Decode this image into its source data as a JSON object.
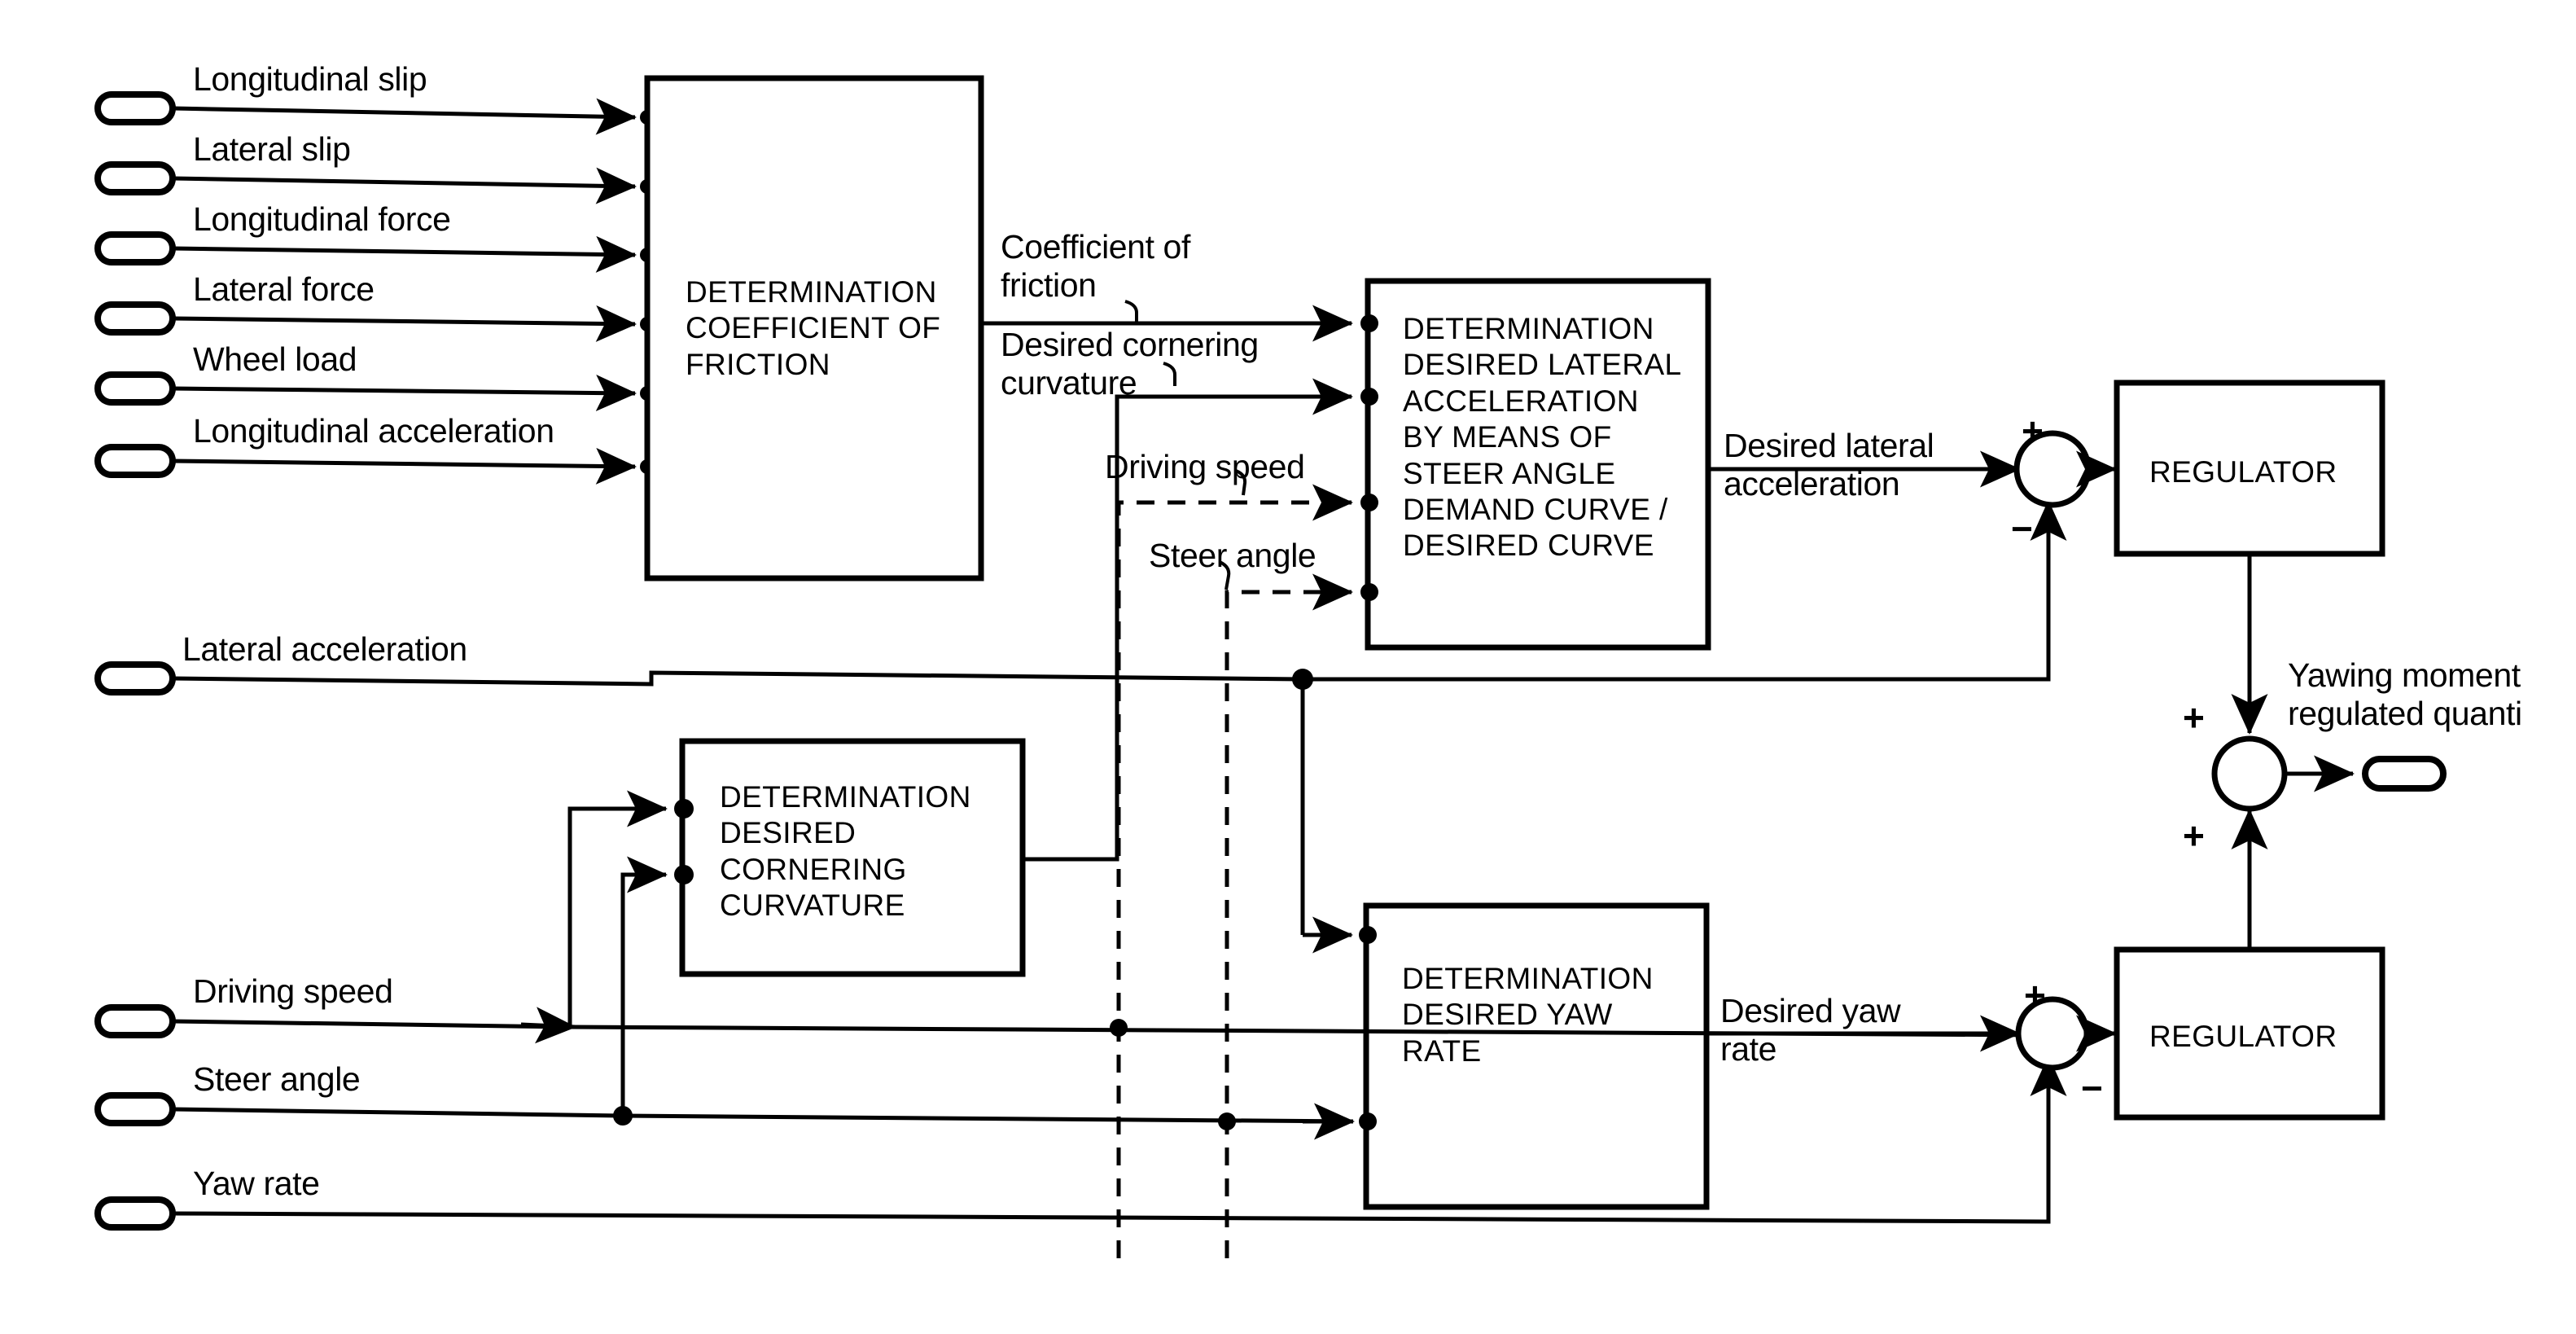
{
  "diagram": {
    "title": "Vehicle dynamics control block diagram",
    "stroke_color": "#000000",
    "background_color": "#ffffff"
  },
  "inputs": [
    {
      "label": "Longitudinal slip",
      "terminal": "signal-terminal"
    },
    {
      "label": "Lateral slip",
      "terminal": "signal-terminal"
    },
    {
      "label": "Longitudinal force",
      "terminal": "signal-terminal"
    },
    {
      "label": "Lateral force",
      "terminal": "signal-terminal"
    },
    {
      "label": "Wheel load",
      "terminal": "signal-terminal"
    },
    {
      "label": "Longitudinal acceleration",
      "terminal": "signal-terminal"
    },
    {
      "label": "Lateral acceleration",
      "terminal": "signal-terminal"
    },
    {
      "label": "Driving speed",
      "terminal": "signal-terminal"
    },
    {
      "label": "Steer angle",
      "terminal": "signal-terminal"
    },
    {
      "label": "Yaw rate",
      "terminal": "signal-terminal"
    }
  ],
  "blocks": {
    "coefficient_of_friction": "DETERMINATION\nCOEFFICIENT OF\nFRICTION",
    "desired_lateral_acceleration": "DETERMINATION\nDESIRED LATERAL\nACCELERATION\nBY MEANS OF\nSTEER ANGLE\nDEMAND CURVE /\nDESIRED CURVE",
    "desired_cornering_curvature": "DETERMINATION\nDESIRED\nCORNERING\nCURVATURE",
    "desired_yaw_rate": "DETERMINATION\nDESIRED YAW\nRATE",
    "regulator_top": "REGULATOR",
    "regulator_bottom": "REGULATOR"
  },
  "signals": {
    "coefficient_of_friction": "Coefficient of\nfriction",
    "desired_cornering_curvature": "Desired cornering\ncurvature",
    "driving_speed": "Driving speed",
    "steer_angle": "Steer angle",
    "desired_lateral_acceleration": "Desired lateral\nacceleration",
    "desired_yaw_rate": "Desired yaw\nrate",
    "output": "Yawing moment\nregulated quanti"
  },
  "signs": {
    "lat_sum_plus": "+",
    "lat_sum_minus": "−",
    "yaw_sum_plus": "+",
    "yaw_sum_minus": "−",
    "out_sum_plus_top": "+",
    "out_sum_plus_bottom": "+"
  }
}
